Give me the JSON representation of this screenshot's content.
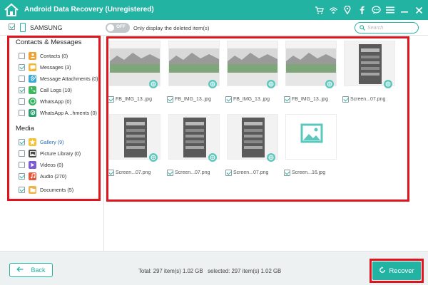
{
  "app": {
    "title": "Android Data Recovery (Unregistered)"
  },
  "window_controls": {
    "icons": [
      "cart-icon",
      "key-icon",
      "pin-icon",
      "facebook-icon",
      "chat-icon",
      "menu-icon",
      "minimize-icon",
      "close-icon"
    ]
  },
  "device": {
    "name": "SAMSUNG",
    "checked": true
  },
  "sidebar": {
    "sections": [
      {
        "title": "Contacts & Messages",
        "items": [
          {
            "label": "Contacts (0)",
            "icon": "contacts-icon",
            "color": "#f0a030",
            "checked": false
          },
          {
            "label": "Messages (3)",
            "icon": "messages-icon",
            "color": "#f4b63a",
            "checked": true
          },
          {
            "label": "Message Attachments (0)",
            "icon": "attachments-icon",
            "color": "#3aa9d8",
            "checked": false
          },
          {
            "label": "Call Logs (10)",
            "icon": "call-logs-icon",
            "color": "#3db85e",
            "checked": true
          },
          {
            "label": "WhatsApp (0)",
            "icon": "whatsapp-icon",
            "color": "#2fb35a",
            "checked": false
          },
          {
            "label": "WhatsApp A...hments (0)",
            "icon": "whatsapp-attachments-icon",
            "color": "#2a9b6a",
            "checked": false
          }
        ]
      },
      {
        "title": "Media",
        "items": [
          {
            "label": "Gallery (9)",
            "icon": "gallery-icon",
            "color": "#f2c23a",
            "checked": true,
            "active": true
          },
          {
            "label": "Picture Library (0)",
            "icon": "picture-library-icon",
            "color": "#4a4a4a",
            "checked": false
          },
          {
            "label": "Videos (0)",
            "icon": "videos-icon",
            "color": "#7b5dd1",
            "checked": false
          },
          {
            "label": "Audio (270)",
            "icon": "audio-icon",
            "color": "#e2573a",
            "checked": true
          },
          {
            "label": "Documents (5)",
            "icon": "documents-icon",
            "color": "#f1b24a",
            "checked": true
          }
        ]
      }
    ]
  },
  "toolbar": {
    "toggle_text": "OFF",
    "only_display_label": "Only display the deleted item(s)",
    "search_placeholder": "Search"
  },
  "gallery": {
    "files": [
      {
        "name": "FB_IMG_13..jpg",
        "kind": "landscape"
      },
      {
        "name": "FB_IMG_13..jpg",
        "kind": "landscape"
      },
      {
        "name": "FB_IMG_13..jpg",
        "kind": "landscape"
      },
      {
        "name": "FB_IMG_13..jpg",
        "kind": "landscape"
      },
      {
        "name": "Screen...07.png",
        "kind": "screenshot"
      },
      {
        "name": "Screen...07.png",
        "kind": "screenshot"
      },
      {
        "name": "Screen...07.png",
        "kind": "screenshot"
      },
      {
        "name": "Screen...07.png",
        "kind": "screenshot"
      },
      {
        "name": "Screen...16.jpg",
        "kind": "placeholder"
      }
    ]
  },
  "footer": {
    "back_label": "Back",
    "total_text": "Total: 297 item(s) 1.02 GB",
    "selected_text": "selected: 297 item(s) 1.02 GB",
    "recover_label": "Recover"
  },
  "colors": {
    "accent": "#22b3a3",
    "highlight": "#e1141e",
    "link": "#2d6fb7"
  }
}
